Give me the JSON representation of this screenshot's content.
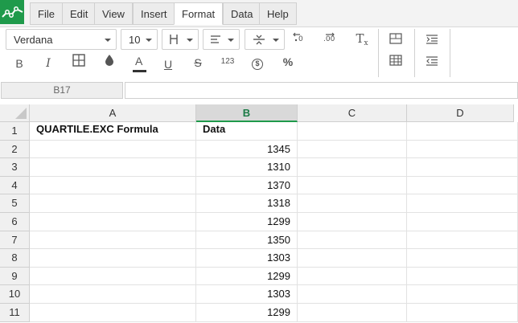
{
  "menu": {
    "items": [
      "File",
      "Edit",
      "View",
      "Insert",
      "Format",
      "Data",
      "Help"
    ],
    "active": "Format"
  },
  "toolbar": {
    "font_family": "Verdana",
    "font_size": "10",
    "bold_label": "B",
    "italic_label": "I",
    "text_color_label": "A",
    "underline_label": "U",
    "strike_label": "S",
    "number_format_label": "123",
    "currency_label": "$",
    "percent_label": "%",
    "clear_format_label": "T"
  },
  "formula_bar": {
    "cell_ref": "B17",
    "value": ""
  },
  "grid": {
    "columns": [
      "A",
      "B",
      "C",
      "D"
    ],
    "selected_column": "B",
    "rows": [
      {
        "num": "1",
        "a": "QUARTILE.EXC Formula",
        "b": "Data"
      },
      {
        "num": "2",
        "a": "",
        "b": "1345"
      },
      {
        "num": "3",
        "a": "",
        "b": "1310"
      },
      {
        "num": "4",
        "a": "",
        "b": "1370"
      },
      {
        "num": "5",
        "a": "",
        "b": "1318"
      },
      {
        "num": "6",
        "a": "",
        "b": "1299"
      },
      {
        "num": "7",
        "a": "",
        "b": "1350"
      },
      {
        "num": "8",
        "a": "",
        "b": "1303"
      },
      {
        "num": "9",
        "a": "",
        "b": "1299"
      },
      {
        "num": "10",
        "a": "",
        "b": "1303"
      },
      {
        "num": "11",
        "a": "",
        "b": "1299"
      }
    ]
  },
  "colors": {
    "accent": "#1f9a4b"
  }
}
